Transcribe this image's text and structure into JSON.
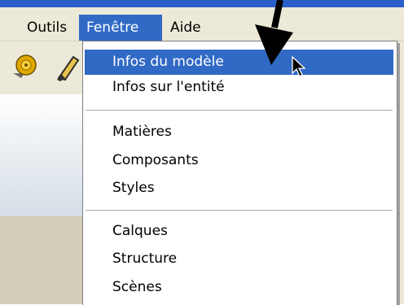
{
  "menubar": {
    "items": [
      {
        "label": "Outils",
        "active": false
      },
      {
        "label": "Fenêtre",
        "active": true
      },
      {
        "label": "Aide",
        "active": false
      }
    ]
  },
  "toolbar": {
    "icons": [
      "tape-measure-icon",
      "paint-bucket-icon",
      "text-tool-icon"
    ]
  },
  "menu": {
    "items": [
      {
        "label": "Infos du modèle",
        "highlighted": true
      },
      {
        "label": "Infos sur l'entité",
        "highlighted": false
      },
      {
        "label": "Matières",
        "highlighted": false
      },
      {
        "label": "Composants",
        "highlighted": false
      },
      {
        "label": "Styles",
        "highlighted": false
      },
      {
        "label": "Calques",
        "highlighted": false
      },
      {
        "label": "Structure",
        "highlighted": false
      },
      {
        "label": "Scènes",
        "highlighted": false
      }
    ]
  },
  "colors": {
    "highlight": "#316ac5",
    "menubar_bg": "#ece9d8",
    "title_bar": "#2a5fcb",
    "annotation_arrow": "#000000"
  }
}
